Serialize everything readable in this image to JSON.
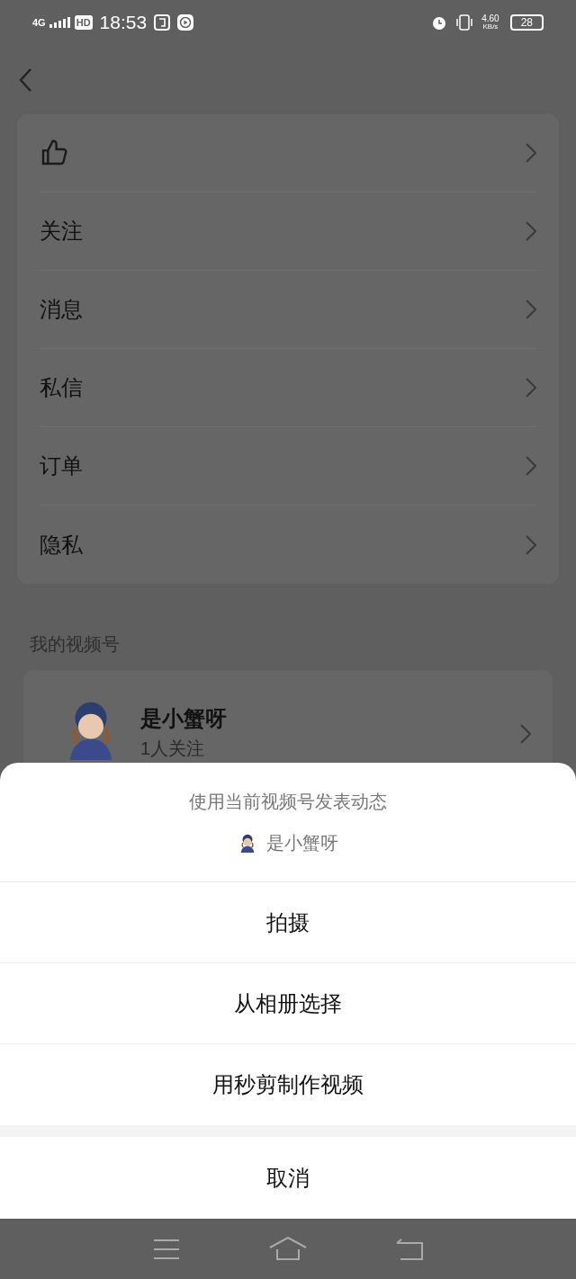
{
  "status_bar": {
    "network": "4G",
    "hd": "HD",
    "time": "18:53",
    "speed": "4.60",
    "speed_unit": "KB/s",
    "battery": "28"
  },
  "menu": {
    "items": [
      {
        "kind": "icon"
      },
      {
        "kind": "text",
        "label": "关注"
      },
      {
        "kind": "text",
        "label": "消息"
      },
      {
        "kind": "text",
        "label": "私信"
      },
      {
        "kind": "text",
        "label": "订单"
      },
      {
        "kind": "text",
        "label": "隐私"
      }
    ]
  },
  "channel_section": {
    "title": "我的视频号",
    "name": "是小蟹呀",
    "followers": "1人关注"
  },
  "sheet": {
    "title": "使用当前视频号发表动态",
    "account": "是小蟹呀",
    "options": [
      "拍摄",
      "从相册选择",
      "用秒剪制作视频"
    ],
    "cancel": "取消"
  }
}
